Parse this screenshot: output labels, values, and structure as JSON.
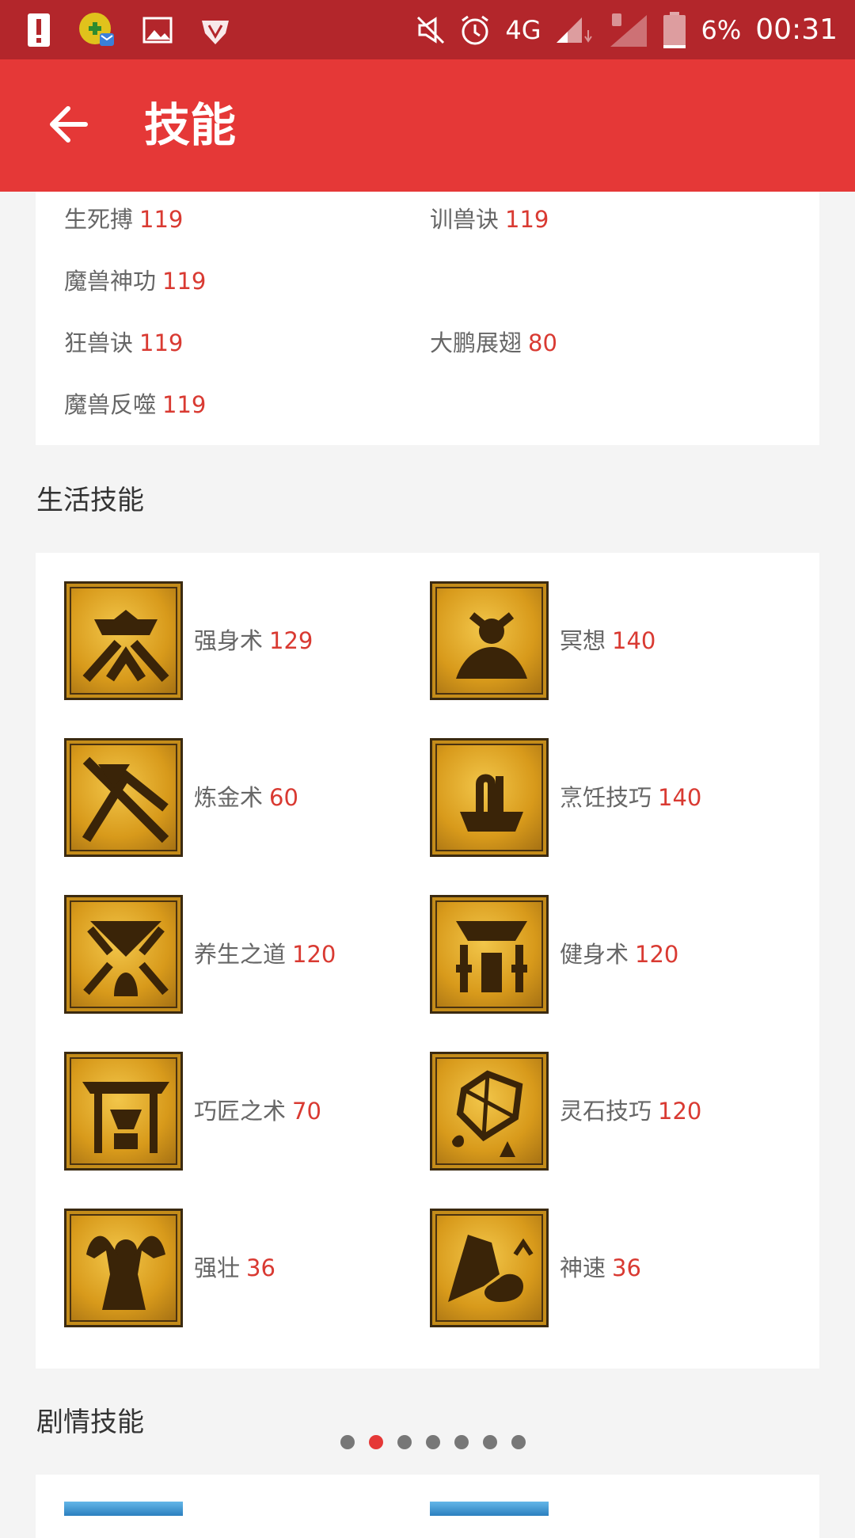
{
  "status_bar": {
    "battery_percent": "6%",
    "time": "00:31",
    "network": "4G"
  },
  "app_bar": {
    "title": "技能",
    "back_icon": "arrow-left-icon"
  },
  "top_skills": [
    {
      "name": "生死搏",
      "level": "119"
    },
    {
      "name": "训兽诀",
      "level": "119"
    },
    {
      "name": "魔兽神功",
      "level": "119"
    },
    {
      "name": "狂兽诀",
      "level": "119"
    },
    {
      "name": "大鹏展翅",
      "level": "80"
    },
    {
      "name": "魔兽反噬",
      "level": "119"
    }
  ],
  "life_section": {
    "title": "生活技能",
    "skills": [
      {
        "name": "强身术",
        "level": "129"
      },
      {
        "name": "冥想",
        "level": "140"
      },
      {
        "name": "炼金术",
        "level": "60"
      },
      {
        "name": "烹饪技巧",
        "level": "140"
      },
      {
        "name": "养生之道",
        "level": "120"
      },
      {
        "name": "健身术",
        "level": "120"
      },
      {
        "name": "巧匠之术",
        "level": "70"
      },
      {
        "name": "灵石技巧",
        "level": "120"
      },
      {
        "name": "强壮",
        "level": "36"
      },
      {
        "name": "神速",
        "level": "36"
      }
    ]
  },
  "story_section": {
    "title": "剧情技能"
  },
  "pagination": {
    "total": 7,
    "current": 2
  },
  "colors": {
    "status_bar": "#b3262b",
    "app_bar": "#e53837",
    "level_text": "#d93a32",
    "background": "#f4f4f4"
  }
}
